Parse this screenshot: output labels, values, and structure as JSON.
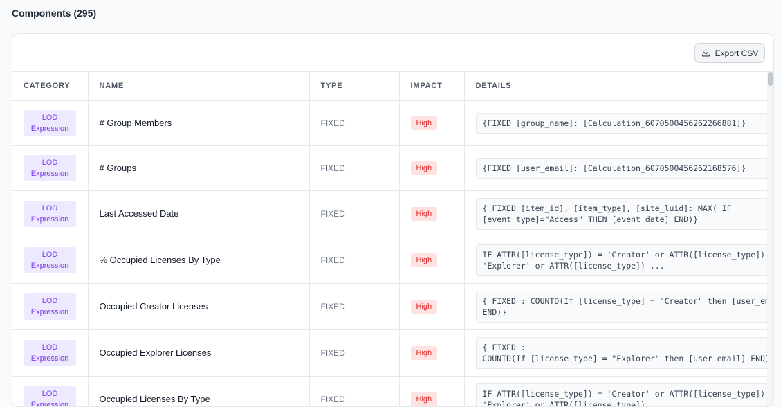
{
  "page": {
    "title": "Components (295)"
  },
  "toolbar": {
    "export_label": "Export CSV"
  },
  "table": {
    "columns": [
      "CATEGORY",
      "NAME",
      "TYPE",
      "IMPACT",
      "DETAILS"
    ],
    "rows": [
      {
        "category": "LOD Expression",
        "name": "# Group Members",
        "type": "FIXED",
        "impact": "High",
        "details": "{FIXED [group_name]: [Calculation_6070500456262266881]}"
      },
      {
        "category": "LOD Expression",
        "name": "# Groups",
        "type": "FIXED",
        "impact": "High",
        "details": "{FIXED [user_email]: [Calculation_6070500456262168576]}"
      },
      {
        "category": "LOD Expression",
        "name": "Last Accessed Date",
        "type": "FIXED",
        "impact": "High",
        "details": "{ FIXED [item_id], [item_type], [site_luid]: MAX( IF\n[event_type]=\"Access\" THEN [event_date] END)}"
      },
      {
        "category": "LOD Expression",
        "name": "% Occupied Licenses By Type",
        "type": "FIXED",
        "impact": "High",
        "details": "IF ATTR([license_type]) = 'Creator' or ATTR([license_type]) =\n'Explorer' or ATTR([license_type]) ..."
      },
      {
        "category": "LOD Expression",
        "name": "Occupied Creator Licenses",
        "type": "FIXED",
        "impact": "High",
        "details": "{ FIXED : COUNTD(If [license_type] = \"Creator\" then [user_email]\nEND)}"
      },
      {
        "category": "LOD Expression",
        "name": "Occupied Explorer Licenses",
        "type": "FIXED",
        "impact": "High",
        "details": "{ FIXED :\nCOUNTD(If [license_type] = \"Explorer\" then [user_email] END)}"
      },
      {
        "category": "LOD Expression",
        "name": "Occupied Licenses By Type",
        "type": "FIXED",
        "impact": "High",
        "details": "IF ATTR([license_type]) = 'Creator' or ATTR([license_type]) =\n'Explorer' or ATTR([license_type]) ..."
      }
    ]
  },
  "colors": {
    "category_badge_bg": "#ede9fe",
    "category_badge_text": "#7c3aed",
    "impact_high_bg": "#fee2e2",
    "impact_high_text": "#dc2626"
  },
  "icons": {
    "export": "download-icon"
  }
}
